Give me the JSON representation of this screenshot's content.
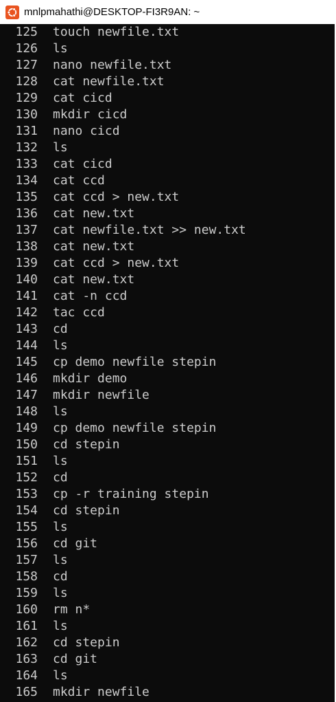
{
  "window": {
    "title": "mnlpmahathi@DESKTOP-FI3R9AN: ~",
    "icon": "ubuntu-icon",
    "icon_color": "#e95420",
    "background": "#0c0c0c",
    "foreground": "#cccccc"
  },
  "history": [
    {
      "num": "125",
      "cmd": "touch newfile.txt"
    },
    {
      "num": "126",
      "cmd": "ls"
    },
    {
      "num": "127",
      "cmd": "nano newfile.txt"
    },
    {
      "num": "128",
      "cmd": "cat newfile.txt"
    },
    {
      "num": "129",
      "cmd": "cat cicd"
    },
    {
      "num": "130",
      "cmd": "mkdir cicd"
    },
    {
      "num": "131",
      "cmd": "nano cicd"
    },
    {
      "num": "132",
      "cmd": "ls"
    },
    {
      "num": "133",
      "cmd": "cat cicd"
    },
    {
      "num": "134",
      "cmd": "cat ccd"
    },
    {
      "num": "135",
      "cmd": "cat ccd > new.txt"
    },
    {
      "num": "136",
      "cmd": "cat new.txt"
    },
    {
      "num": "137",
      "cmd": "cat newfile.txt >> new.txt"
    },
    {
      "num": "138",
      "cmd": "cat new.txt"
    },
    {
      "num": "139",
      "cmd": "cat ccd > new.txt"
    },
    {
      "num": "140",
      "cmd": "cat new.txt"
    },
    {
      "num": "141",
      "cmd": "cat -n ccd"
    },
    {
      "num": "142",
      "cmd": "tac ccd"
    },
    {
      "num": "143",
      "cmd": "cd"
    },
    {
      "num": "144",
      "cmd": "ls"
    },
    {
      "num": "145",
      "cmd": "cp demo newfile stepin"
    },
    {
      "num": "146",
      "cmd": "mkdir demo"
    },
    {
      "num": "147",
      "cmd": "mkdir newfile"
    },
    {
      "num": "148",
      "cmd": "ls"
    },
    {
      "num": "149",
      "cmd": "cp demo newfile stepin"
    },
    {
      "num": "150",
      "cmd": "cd stepin"
    },
    {
      "num": "151",
      "cmd": "ls"
    },
    {
      "num": "152",
      "cmd": "cd"
    },
    {
      "num": "153",
      "cmd": "cp -r training stepin"
    },
    {
      "num": "154",
      "cmd": "cd stepin"
    },
    {
      "num": "155",
      "cmd": "ls"
    },
    {
      "num": "156",
      "cmd": "cd git"
    },
    {
      "num": "157",
      "cmd": "ls"
    },
    {
      "num": "158",
      "cmd": "cd"
    },
    {
      "num": "159",
      "cmd": "ls"
    },
    {
      "num": "160",
      "cmd": "rm n*"
    },
    {
      "num": "161",
      "cmd": "ls"
    },
    {
      "num": "162",
      "cmd": "cd stepin"
    },
    {
      "num": "163",
      "cmd": "cd git"
    },
    {
      "num": "164",
      "cmd": "ls"
    },
    {
      "num": "165",
      "cmd": "mkdir newfile"
    }
  ]
}
